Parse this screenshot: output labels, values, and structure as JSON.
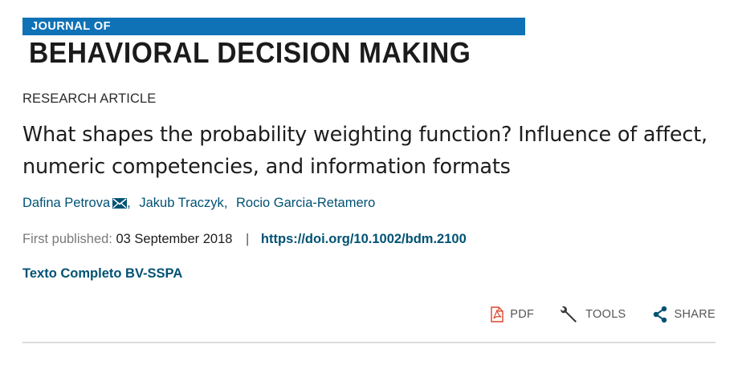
{
  "journal": {
    "name_top": "JOURNAL OF",
    "name_main": "BEHAVIORAL DECISION MAKING",
    "brand_color": "#0f72b6"
  },
  "article": {
    "type": "RESEARCH ARTICLE",
    "title": "What shapes the probability weighting function? Influence of affect, numeric competencies, and information formats",
    "authors": [
      {
        "name": "Dafina Petrova",
        "corresponding": true
      },
      {
        "name": "Jakub Traczyk",
        "corresponding": false
      },
      {
        "name": "Rocio Garcia-Retamero",
        "corresponding": false
      }
    ],
    "published_label": "First published:",
    "published_date": "03 September 2018",
    "pub_divider": "|",
    "doi": "https://doi.org/10.1002/bdm.2100",
    "full_text_link": "Texto Completo BV-SSPA"
  },
  "toolbar": {
    "pdf_label": "PDF",
    "tools_label": "TOOLS",
    "share_label": "SHARE"
  },
  "colors": {
    "link": "#005274",
    "pdf_icon": "#d9462b"
  },
  "icons": {
    "mail": "envelope-icon",
    "pdf": "pdf-icon",
    "tools": "wrench-icon",
    "share": "share-icon"
  }
}
